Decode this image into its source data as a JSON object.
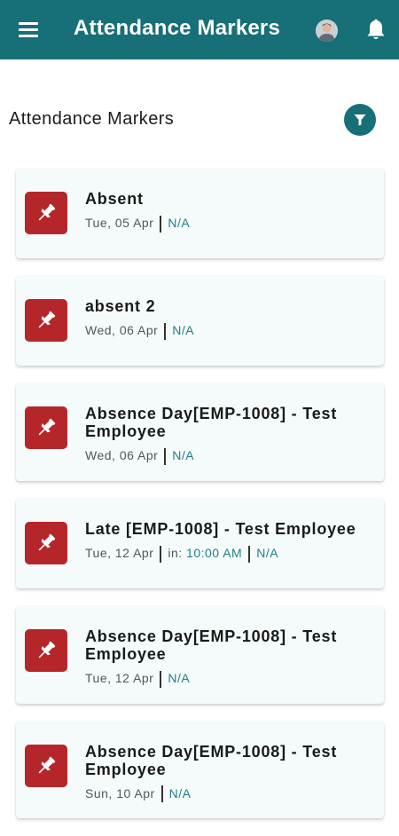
{
  "appbar": {
    "title": "Attendance Markers",
    "icons": [
      "hamburger-menu-icon",
      "avatar",
      "bell-icon"
    ]
  },
  "section": {
    "title": "Attendance Markers",
    "filter_icon": "filter-icon"
  },
  "colors": {
    "primary": "#176f78",
    "pin_background": "#b5262a",
    "card_background": "#f5fbfb",
    "status_text": "#1f7f86"
  },
  "markers": [
    {
      "title": "Absent",
      "date": "Tue, 05 Apr",
      "status": "N/A"
    },
    {
      "title": "absent 2",
      "date": "Wed, 06 Apr",
      "status": "N/A"
    },
    {
      "title": "Absence Day[EMP-1008] -  Test Employee",
      "date": "Wed, 06 Apr",
      "status": "N/A"
    },
    {
      "title": "Late [EMP-1008] -  Test Employee",
      "date": "Tue, 12 Apr",
      "in_label": "in:",
      "in_time": "10:00 AM",
      "status": "N/A"
    },
    {
      "title": "Absence Day[EMP-1008] -  Test Employee",
      "date": "Tue, 12 Apr",
      "status": "N/A"
    },
    {
      "title": "Absence Day[EMP-1008] -  Test Employee",
      "date": "Sun, 10 Apr",
      "status": "N/A"
    }
  ]
}
